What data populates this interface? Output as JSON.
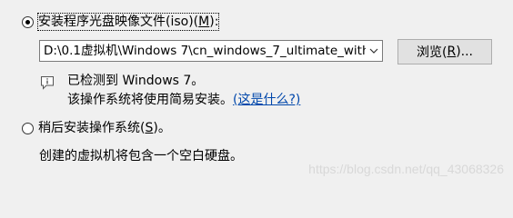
{
  "install_source": {
    "iso_option": {
      "label_main": "安装程序光盘映像文件(iso)(",
      "label_key": "M",
      "label_end": "):",
      "checked": true
    },
    "iso_path": "D:\\0.1虚拟机\\Windows 7\\cn_windows_7_ultimate_with",
    "browse_button": {
      "label_main": "浏览(",
      "label_key": "R",
      "label_end": ")..."
    },
    "detection": {
      "icon": "info-balloon-icon",
      "detected_text": "已检测到 Windows 7。",
      "note_text": "该操作系统将使用简易安装。",
      "link_text": "(这是什么?)"
    },
    "later_option": {
      "label_main": "稍后安装操作系统(",
      "label_key": "S",
      "label_end": ")。",
      "checked": false
    },
    "later_description": "创建的虚拟机将包含一个空白硬盘。"
  },
  "watermark": "https://blog.csdn.net/qq_43068326",
  "colors": {
    "background": "#f0f0f0",
    "link": "#0047ab"
  }
}
